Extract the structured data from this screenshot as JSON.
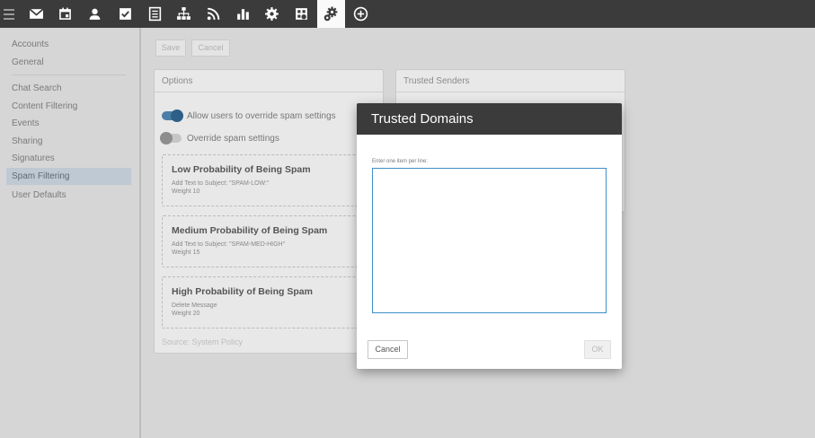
{
  "topbar": {
    "icons": [
      "hamburger-icon",
      "mail-icon",
      "calendar-icon",
      "contacts-icon",
      "tasks-icon",
      "notes-icon",
      "org-chart-icon",
      "rss-icon",
      "reports-icon",
      "settings-icon",
      "domain-settings-icon",
      "admin-settings-icon",
      "add-icon"
    ],
    "active": "admin-settings-icon"
  },
  "toolbar": {
    "save_label": "Save",
    "cancel_label": "Cancel"
  },
  "sidebar": {
    "items": [
      {
        "label": "Accounts"
      },
      {
        "label": "General"
      },
      {
        "label": "Chat Search"
      },
      {
        "label": "Content Filtering"
      },
      {
        "label": "Events"
      },
      {
        "label": "Sharing"
      },
      {
        "label": "Signatures"
      },
      {
        "label": "Spam Filtering",
        "selected": true
      },
      {
        "label": "User Defaults"
      }
    ]
  },
  "options": {
    "title": "Options",
    "allow_override_label": "Allow users to override spam settings",
    "allow_override_on": true,
    "override_label": "Override spam settings",
    "override_on": false,
    "rules": [
      {
        "title": "Low Probability of Being Spam",
        "line1": "Add Text to Subject: \"SPAM-LOW:\"",
        "line2": "Weight 10"
      },
      {
        "title": "Medium Probability of Being Spam",
        "line1": "Add Text to Subject: \"SPAM-MED-HIGH\"",
        "line2": "Weight 15"
      },
      {
        "title": "High Probability of Being Spam",
        "line1": "Delete Message",
        "line2": "Weight 20"
      }
    ],
    "source": "Source: System Policy"
  },
  "trusted_senders": {
    "title": "Trusted Senders"
  },
  "modal": {
    "title": "Trusted Domains",
    "field_label": "Enter one item per line:",
    "field_value": "",
    "cancel_label": "Cancel",
    "ok_label": "OK"
  },
  "colors": {
    "topbar": "#3b3b3b",
    "accent": "#2d5f88",
    "selected_nav": "#bfc9d3",
    "textarea_border": "#3e8fc8"
  }
}
